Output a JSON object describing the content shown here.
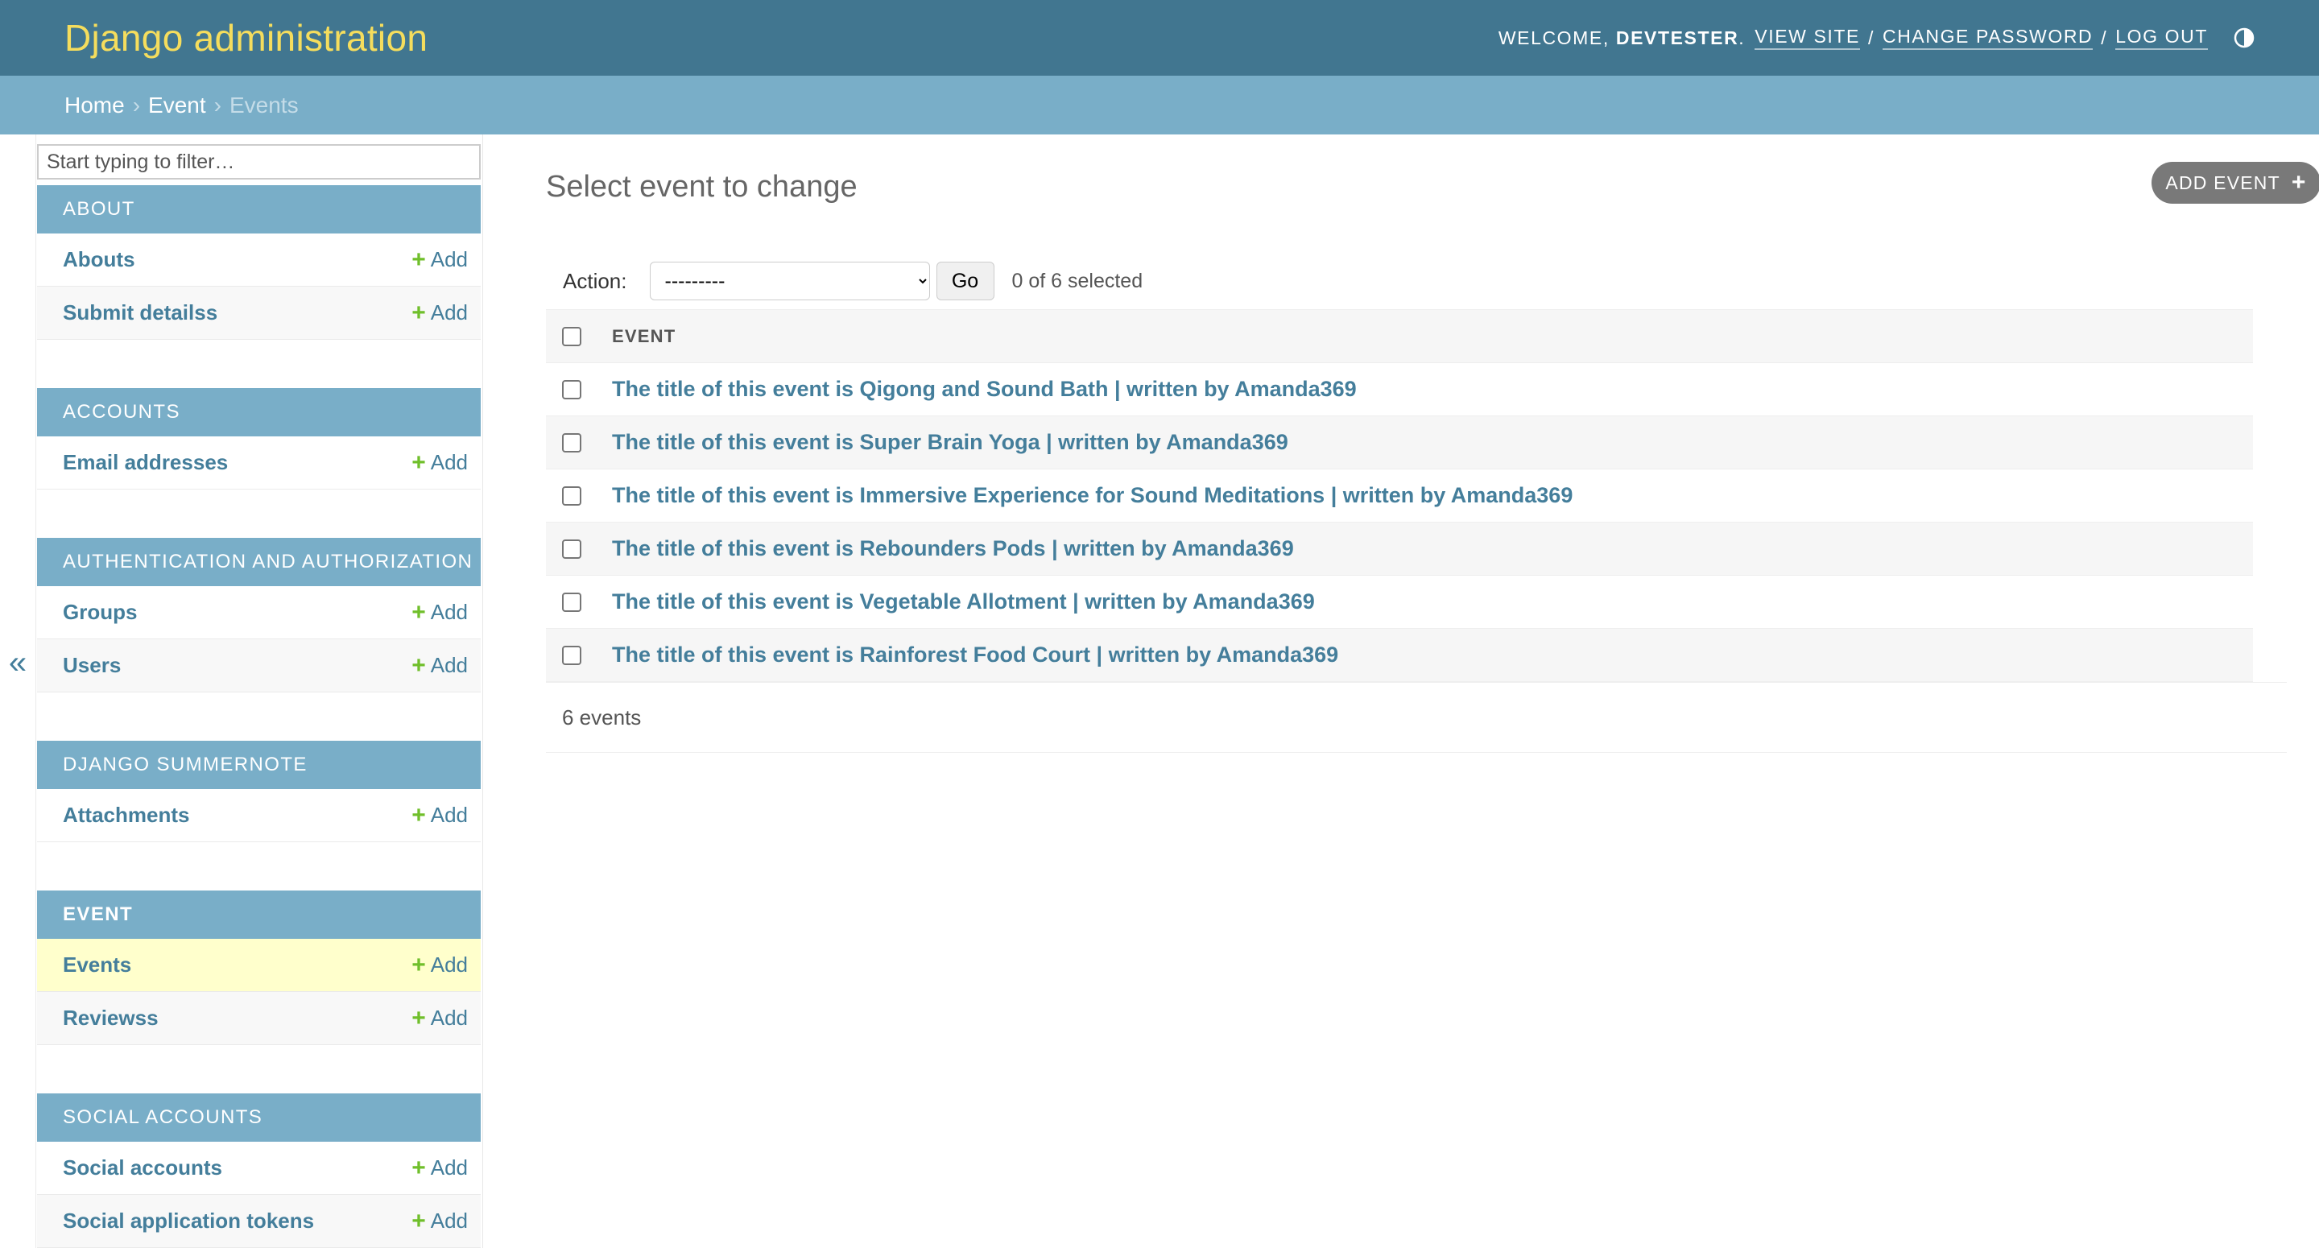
{
  "header": {
    "site_title": "Django administration",
    "welcome_prefix": "Welcome,",
    "username": "devtester",
    "welcome_suffix": ".",
    "view_site": "View site",
    "change_password": "Change password",
    "log_out": "Log out",
    "separator": "/",
    "theme_icon": "contrast-half-circle-icon"
  },
  "breadcrumbs": {
    "home": "Home",
    "app": "Event",
    "current": "Events",
    "separator": "›"
  },
  "sidebar": {
    "filter_placeholder": "Start typing to filter…",
    "collapse_glyph": "«",
    "add_label": "Add",
    "add_plus": "+",
    "modules": [
      {
        "caption": "About",
        "models": [
          "Abouts",
          "Submit detailss"
        ]
      },
      {
        "caption": "Accounts",
        "models": [
          "Email addresses"
        ]
      },
      {
        "caption": "Authentication and Authorization",
        "models": [
          "Groups",
          "Users"
        ]
      },
      {
        "caption": "Django Summernote",
        "models": [
          "Attachments"
        ]
      },
      {
        "caption": "Event",
        "models": [
          "Events",
          "Reviewss"
        ]
      },
      {
        "caption": "Social Accounts",
        "models": [
          "Social accounts",
          "Social application tokens"
        ]
      }
    ]
  },
  "main": {
    "heading": "Select event to change",
    "add_button": "Add event",
    "add_button_icon": "+",
    "action_label": "Action:",
    "action_selected": "---------",
    "go_button": "Go",
    "selection_count": "0 of 6 selected",
    "column_header": "Event",
    "rows": [
      "The title of this event is Qigong and Sound Bath | written by Amanda369",
      "The title of this event is Super Brain Yoga | written by Amanda369",
      "The title of this event is Immersive Experience for Sound Meditations | written by Amanda369",
      "The title of this event is Rebounders Pods | written by Amanda369",
      "The title of this event is Vegetable Allotment | written by Amanda369",
      "The title of this event is Rainforest Food Court | written by Amanda369"
    ],
    "result_count": "6 events"
  },
  "colors": {
    "header_bg": "#417690",
    "breadcrumb_bg": "#79aec8",
    "site_title": "#f5dd5d",
    "link": "#447e9b",
    "add_plus": "#70bf2b",
    "current_model_bg": "#ffffcc"
  }
}
